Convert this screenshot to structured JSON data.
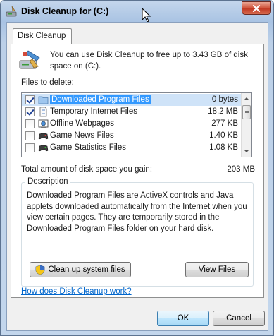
{
  "window": {
    "title": "Disk Cleanup for  (C:)",
    "icons": {
      "app": "disk-cleanup-icon",
      "close": "close-icon",
      "cursor": "mouse-pointer-icon"
    }
  },
  "tabs": [
    {
      "label": "Disk Cleanup",
      "selected": true
    }
  ],
  "intro": {
    "icon": "disk-cleanup-broom-icon",
    "text": "You can use Disk Cleanup to free up to 3.43 GB of disk space on  (C:)."
  },
  "files": {
    "label": "Files to delete:",
    "rows": [
      {
        "name": "Downloaded Program Files",
        "size": "0 bytes",
        "checked": true,
        "selected": true,
        "icon": "folder-icon"
      },
      {
        "name": "Temporary Internet Files",
        "size": "18.2 MB",
        "checked": true,
        "selected": false,
        "icon": "document-icon"
      },
      {
        "name": "Offline Webpages",
        "size": "277 KB",
        "checked": false,
        "selected": false,
        "icon": "offline-webpages-icon"
      },
      {
        "name": "Game News Files",
        "size": "1.40 KB",
        "checked": false,
        "selected": false,
        "icon": "game-controller-icon"
      },
      {
        "name": "Game Statistics Files",
        "size": "1.08 KB",
        "checked": false,
        "selected": false,
        "icon": "game-controller-icon"
      }
    ]
  },
  "total": {
    "label": "Total amount of disk space you gain:",
    "value": "203 MB"
  },
  "description": {
    "title": "Description",
    "text": "Downloaded Program Files are ActiveX controls and Java applets downloaded automatically from the Internet when you view certain pages. They are temporarily stored in the Downloaded Program Files folder on your hard disk."
  },
  "buttons": {
    "cleanup_system": "Clean up system files",
    "view_files": "View Files",
    "ok": "OK",
    "cancel": "Cancel"
  },
  "help_link": "How does Disk Cleanup work?"
}
